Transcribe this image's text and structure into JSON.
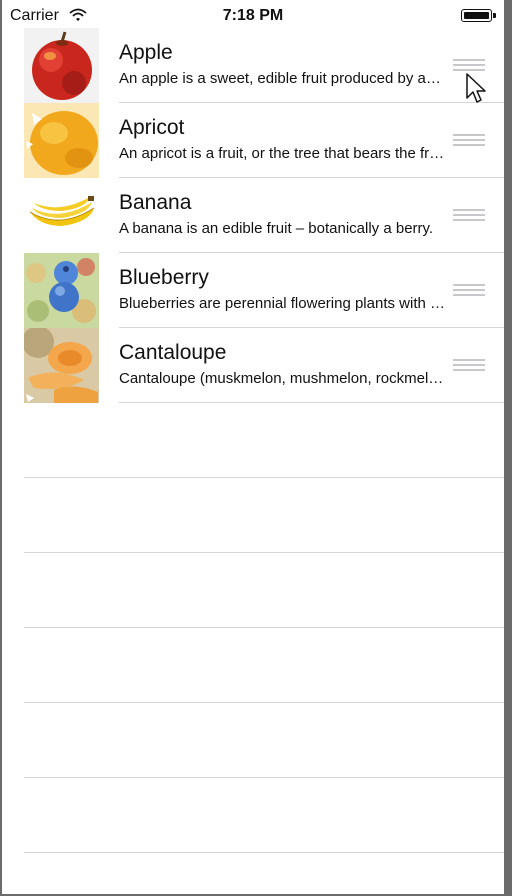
{
  "status_bar": {
    "carrier": "Carrier",
    "time": "7:18 PM",
    "wifi_icon": "wifi-icon",
    "battery_icon": "battery-icon"
  },
  "fruits": [
    {
      "title": "Apple",
      "subtitle": "An apple is a sweet, edible fruit produced by an apple tree.",
      "image": "apple-image"
    },
    {
      "title": "Apricot",
      "subtitle": "An apricot is a fruit, or the tree that bears the fruit.",
      "image": "apricot-image"
    },
    {
      "title": "Banana",
      "subtitle": "A banana is an edible fruit – botanically a berry.",
      "image": "banana-image"
    },
    {
      "title": "Blueberry",
      "subtitle": "Blueberries are perennial flowering plants with blue berries.",
      "image": "blueberry-image"
    },
    {
      "title": "Cantaloupe",
      "subtitle": "Cantaloupe (muskmelon, mushmelon, rockmelon, sweet melon)",
      "image": "cantaloupe-image"
    }
  ],
  "row_accessory_icon": "reorder-handle-icon",
  "colors": {
    "separator": "#d6d6d6",
    "reorder_handle": "#c7c7cc",
    "background": "#ffffff"
  }
}
